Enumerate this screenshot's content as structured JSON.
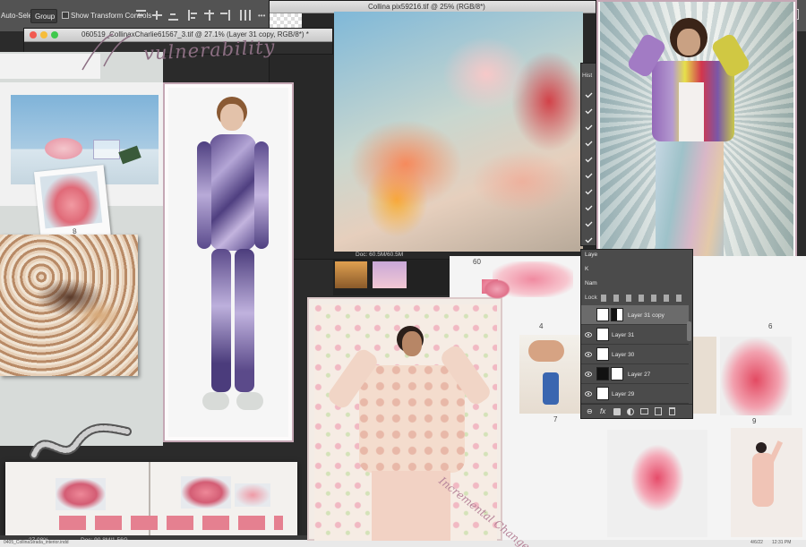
{
  "options_bar": {
    "auto_select_label": "Auto-Select:",
    "group_value": "Group",
    "show_transform_label": "Show Transform Controls"
  },
  "windows": {
    "back_title": "Collina pix59216.tif @ 25% (RGB/8*)",
    "front_title": "060519_CollinaxCharlie61567_3.tif @ 27.1% (Layer 31 copy, RGB/8*) *",
    "doc_size": "Doc: 60.5M/60.5M",
    "bottom_status_left": "27.08%",
    "bottom_status_mid": "Doc: 90.8M/1.56G",
    "bottom_file": "0405_CollinaStrada_interior.indd",
    "bottom_date": "4/6/22",
    "bottom_time": "12:31 PM"
  },
  "history_panel": {
    "tab_label": "Hist"
  },
  "layers_panel": {
    "tab_label": "Laye",
    "search_label": "K",
    "name_label": "Nam",
    "lock_label": "Lock",
    "layers": [
      {
        "name": "Layer 31 copy",
        "selected": true
      },
      {
        "name": "Layer 31",
        "selected": false
      },
      {
        "name": "Layer 30",
        "selected": false
      },
      {
        "name": "Layer 27",
        "selected": false
      },
      {
        "name": "Layer 29",
        "selected": false
      }
    ],
    "footer_icons": [
      "link-icon",
      "fx-icon",
      "mask-icon",
      "adjustment-icon",
      "group-icon",
      "new-layer-icon",
      "trash-icon"
    ]
  },
  "collage_text": {
    "vulnerability": "vulnerability",
    "incremental_change": "Incremental Change",
    "page_number_8": "8",
    "page_number_4": "4",
    "page_number_5": "5",
    "page_number_6": "6",
    "page_number_7": "7",
    "page_number_9": "9",
    "spread_number": "60"
  },
  "colors": {
    "frame_pink": "#c5a8b5",
    "panel_gray": "#4b4b4b",
    "script_mauve": "#8c6f83",
    "selected_layer": "#6b6b6b"
  }
}
